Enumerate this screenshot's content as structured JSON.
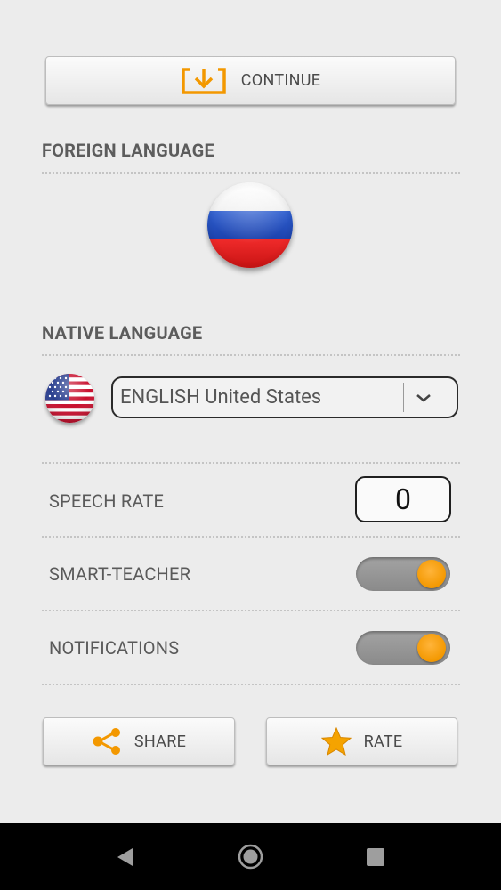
{
  "buttons": {
    "continue_label": "CONTINUE",
    "share_label": "SHARE",
    "rate_label": "RATE"
  },
  "foreign_language": {
    "title": "FOREIGN LANGUAGE",
    "flag": "russia-flag-icon"
  },
  "native_language": {
    "title": "NATIVE LANGUAGE",
    "flag": "usa-flag-icon",
    "selected": "ENGLISH United States"
  },
  "settings": {
    "speech_rate_label": "SPEECH RATE",
    "speech_rate_value": "0",
    "smart_teacher_label": "SMART-TEACHER",
    "smart_teacher_on": true,
    "notifications_label": "NOTIFICATIONS",
    "notifications_on": true
  },
  "colors": {
    "accent": "#f39800",
    "background": "#ececec",
    "text": "#5a5a5a"
  },
  "navbar": {
    "icons": [
      "back-icon",
      "home-icon",
      "recent-apps-icon"
    ]
  }
}
